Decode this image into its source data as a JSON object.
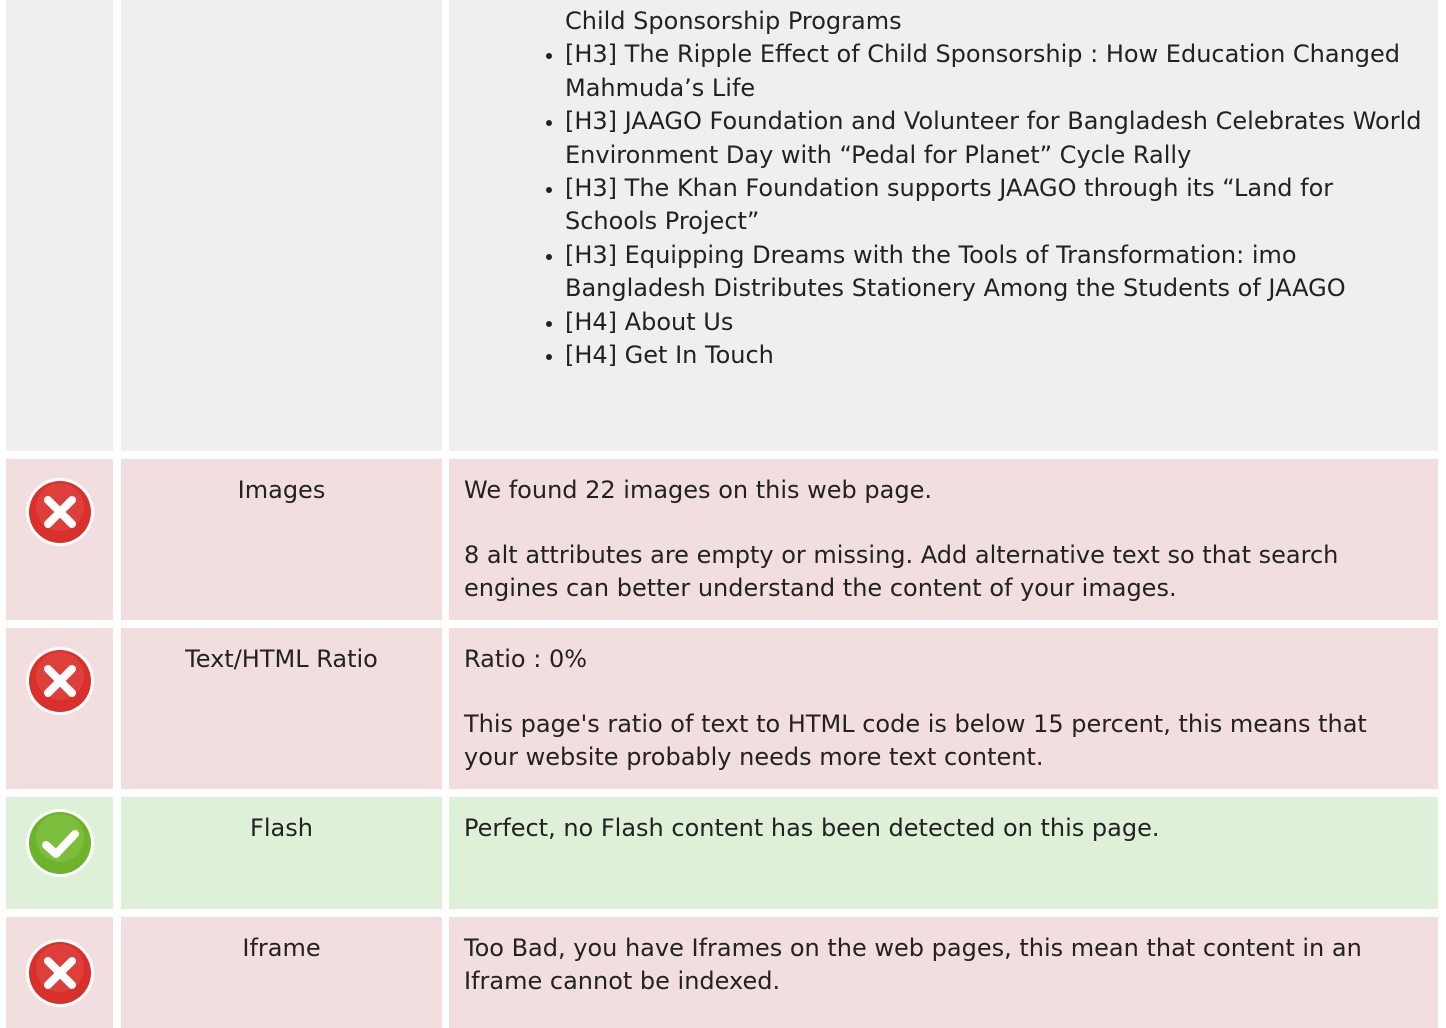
{
  "colors": {
    "error_bg": "#f2dede",
    "success_bg": "#dff0d8",
    "neutral_bg": "#efefef",
    "error_icon": "#d9302c",
    "success_icon": "#6db32c"
  },
  "headings_row": {
    "items": [
      "Child Sponsorship Programs",
      "[H3] The Ripple Effect of Child Sponsorship : How Education Changed Mahmuda’s Life",
      "[H3] JAAGO Foundation and Volunteer for Bangladesh Celebrates World Environment Day with “Pedal for Planet” Cycle Rally",
      "[H3] The Khan Foundation supports JAAGO through its “Land for Schools Project”",
      "[H3] Equipping Dreams with the Tools of Transformation: imo Bangladesh Distributes Stationery Among the Students of JAAGO",
      "[H4] About Us",
      "[H4] Get In Touch"
    ]
  },
  "rows": [
    {
      "status": "error",
      "icon": "error-x-icon",
      "label": "Images",
      "paragraphs": [
        "We found 22 images on this web page.",
        "8 alt attributes are empty or missing. Add alternative text so that search engines can better understand the content of your images."
      ]
    },
    {
      "status": "error",
      "icon": "error-x-icon",
      "label": "Text/HTML Ratio",
      "paragraphs": [
        "Ratio : 0%",
        "This page's ratio of text to HTML code is below 15 percent, this means that your website probably needs more text content."
      ]
    },
    {
      "status": "success",
      "icon": "success-check-icon",
      "label": "Flash",
      "paragraphs": [
        "Perfect, no Flash content has been detected on this page."
      ]
    },
    {
      "status": "error",
      "icon": "error-x-icon",
      "label": "Iframe",
      "paragraphs": [
        "Too Bad, you have Iframes on the web pages, this mean that content in an Iframe cannot be indexed."
      ]
    }
  ]
}
